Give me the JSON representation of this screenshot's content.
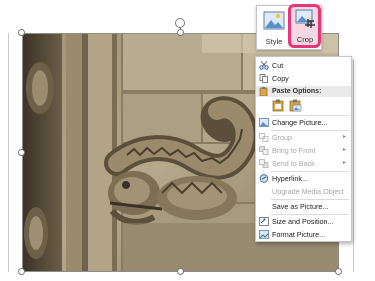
{
  "toolbar": {
    "style_label": "Style",
    "crop_label": "Crop",
    "accent_color": "#e8357a"
  },
  "context_menu": {
    "cut": "Cut",
    "copy": "Copy",
    "paste_options": "Paste Options:",
    "change_picture": "Change Picture...",
    "group": "Group",
    "bring_to_front": "Bring to Front",
    "send_to_back": "Send to Back",
    "hyperlink": "Hyperlink...",
    "upgrade_media": "Upgrade Media Object",
    "save_as_picture": "Save as Picture...",
    "size_and_position": "Size and Position...",
    "format_picture": "Format Picture..."
  },
  "icons": [
    "picture-style-icon",
    "crop-icon",
    "scissors-icon",
    "copy-icon",
    "paste-icon",
    "paste-picture-icon",
    "change-picture-icon",
    "group-icon",
    "bring-to-front-icon",
    "send-to-back-icon",
    "hyperlink-icon",
    "save-picture-icon",
    "size-position-icon",
    "format-picture-icon",
    "rotate-handle-icon"
  ]
}
